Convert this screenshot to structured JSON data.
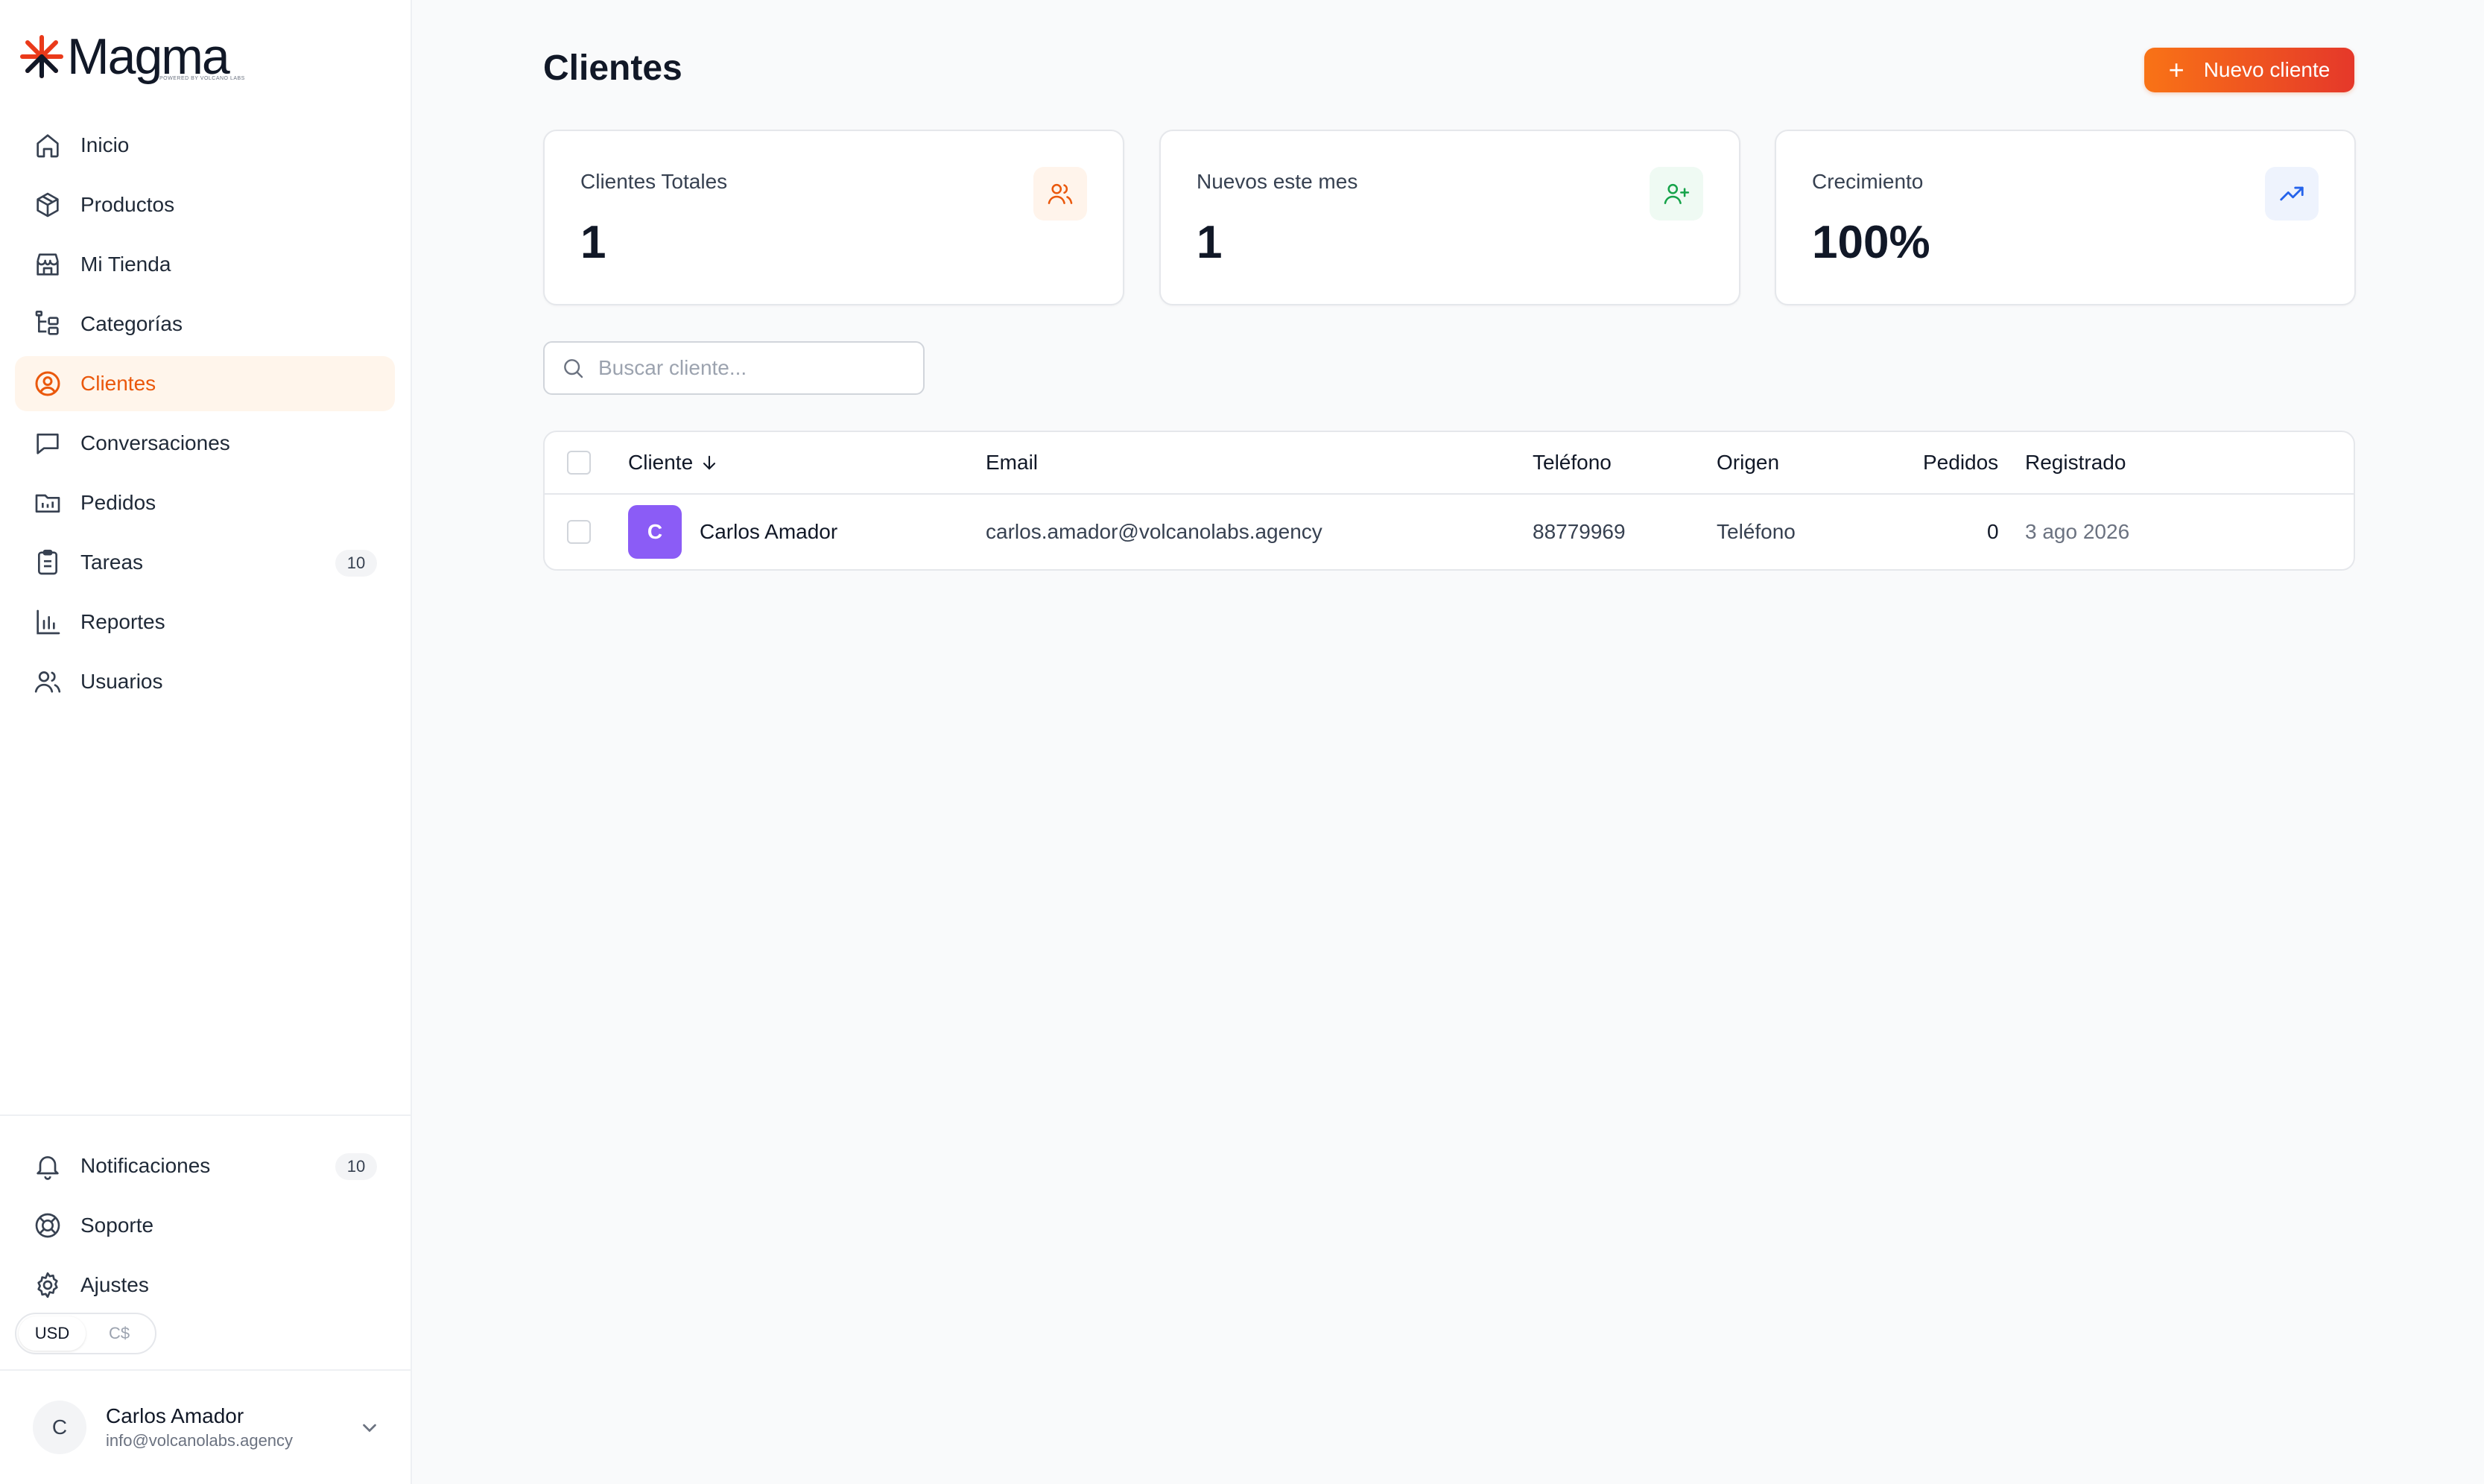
{
  "brand": {
    "name": "Magma",
    "tagline": "POWERED BY VOLCANO LABS",
    "accent": "#ea580c"
  },
  "sidebar": {
    "items": [
      {
        "label": "Inicio",
        "icon": "home-icon"
      },
      {
        "label": "Productos",
        "icon": "box-icon"
      },
      {
        "label": "Mi Tienda",
        "icon": "store-icon"
      },
      {
        "label": "Categorías",
        "icon": "categories-icon"
      },
      {
        "label": "Clientes",
        "icon": "user-circle-icon",
        "active": true
      },
      {
        "label": "Conversaciones",
        "icon": "chat-icon"
      },
      {
        "label": "Pedidos",
        "icon": "orders-icon"
      },
      {
        "label": "Tareas",
        "icon": "clipboard-icon",
        "badge": "10"
      },
      {
        "label": "Reportes",
        "icon": "bar-chart-icon"
      },
      {
        "label": "Usuarios",
        "icon": "users-icon"
      }
    ],
    "bottom": [
      {
        "label": "Notificaciones",
        "icon": "bell-icon",
        "badge": "10"
      },
      {
        "label": "Soporte",
        "icon": "lifebuoy-icon"
      },
      {
        "label": "Ajustes",
        "icon": "gear-icon"
      }
    ],
    "currency": {
      "options": [
        "USD",
        "C$"
      ],
      "selected": "USD"
    },
    "user": {
      "initial": "C",
      "name": "Carlos Amador",
      "email": "info@volcanolabs.agency"
    }
  },
  "main": {
    "title": "Clientes",
    "new_button": {
      "label": "Nuevo cliente",
      "icon": "plus-icon"
    },
    "stats": [
      {
        "label": "Clientes Totales",
        "value": "1",
        "icon": "users-icon",
        "color": "#ea580c",
        "bg": "#fff4eb"
      },
      {
        "label": "Nuevos este mes",
        "value": "1",
        "icon": "user-plus-icon",
        "color": "#16a34a",
        "bg": "#effaf3"
      },
      {
        "label": "Crecimiento",
        "value": "100%",
        "icon": "trending-up-icon",
        "color": "#2563eb",
        "bg": "#eef3fd"
      }
    ],
    "search": {
      "placeholder": "Buscar cliente...",
      "value": ""
    },
    "table": {
      "columns": {
        "cliente": "Cliente",
        "email": "Email",
        "telefono": "Teléfono",
        "origen": "Origen",
        "pedidos": "Pedidos",
        "registrado": "Registrado"
      },
      "sort_icon": "arrow-down-icon",
      "rows": [
        {
          "initial": "C",
          "avatar_color": "#8b5cf6",
          "name": "Carlos Amador",
          "email": "carlos.amador@volcanolabs.agency",
          "phone": "88779969",
          "origin": "Teléfono",
          "orders": "0",
          "registered": "3 ago 2026"
        }
      ]
    }
  }
}
